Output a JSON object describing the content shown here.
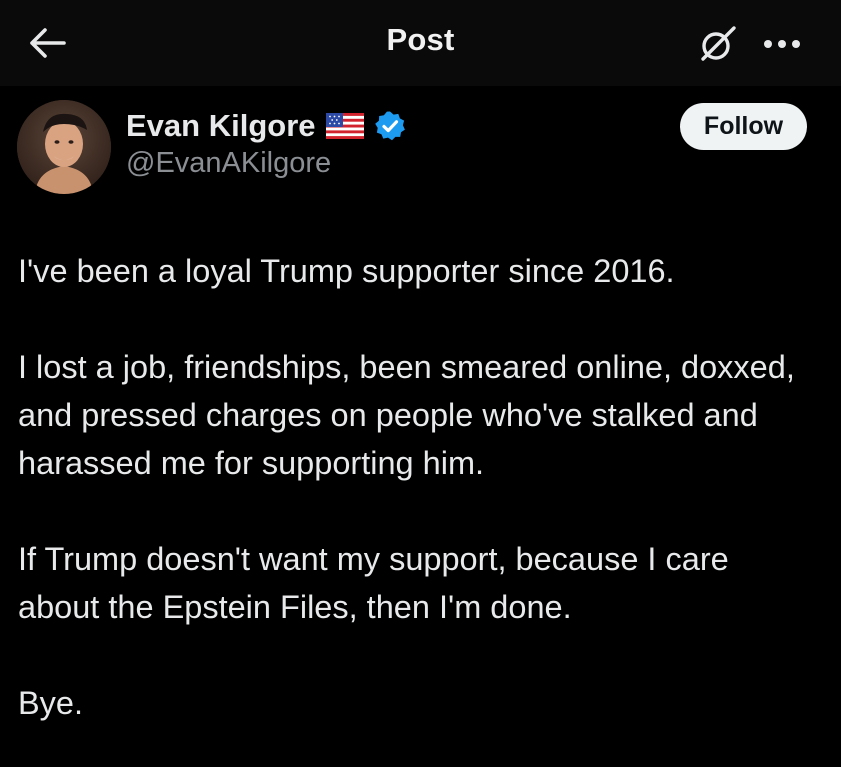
{
  "header": {
    "title": "Post"
  },
  "author": {
    "display_name": "Evan Kilgore",
    "handle": "@EvanAKilgore",
    "flag_icon": "us-flag-icon",
    "verified_icon": "verified-badge-icon",
    "verified_color": "#1d9bf0"
  },
  "follow_button": {
    "label": "Follow"
  },
  "post": {
    "paragraphs": [
      "I've been a loyal Trump supporter since 2016.",
      "I lost a job, friendships, been smeared online, doxxed, and pressed charges on people who've stalked and harassed me for supporting him.",
      "If Trump doesn't want my support, because I care about the Epstein Files, then I'm done.",
      "Bye."
    ]
  },
  "icons": {
    "back": "arrow-left-icon",
    "grok": "grok-icon",
    "more": "more-horizontal-icon"
  },
  "colors": {
    "background": "#000000",
    "text": "#e7e9ea",
    "secondary_text": "#8b8f94",
    "follow_bg": "#eff3f4"
  }
}
